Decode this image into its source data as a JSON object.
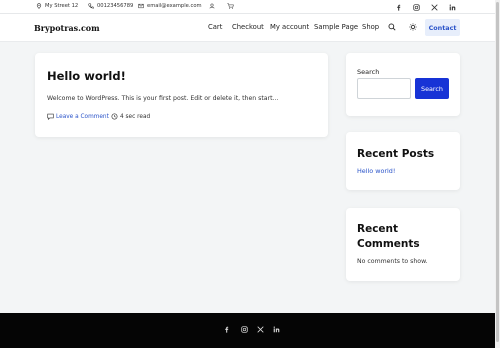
{
  "topbar": {
    "address": "My Street 12",
    "phone": "00123456789",
    "email": "email@example.com",
    "icons": [
      "map-pin-icon",
      "phone-icon",
      "mail-icon",
      "user-icon",
      "cart-icon"
    ],
    "social": [
      "facebook-icon",
      "instagram-icon",
      "x-icon",
      "linkedin-icon"
    ]
  },
  "header": {
    "logo": "Brypotras.com",
    "nav": [
      "Cart",
      "Checkout",
      "My account",
      "Sample Page",
      "Shop"
    ],
    "contact_label": "Contact"
  },
  "post": {
    "title": "Hello world!",
    "excerpt": "Welcome to WordPress. This is your first post. Edit or delete it, then start...",
    "comment_link": "Leave a Comment",
    "read_time": "4 sec read"
  },
  "sidebar": {
    "search": {
      "label": "Search",
      "placeholder": "",
      "button": "Search"
    },
    "recent_posts": {
      "title": "Recent Posts",
      "items": [
        "Hello world!"
      ]
    },
    "recent_comments": {
      "title_line1": "Recent",
      "title_line2": "Comments",
      "empty": "No comments to show."
    }
  },
  "footer": {
    "social": [
      "facebook-icon",
      "instagram-icon",
      "x-icon",
      "linkedin-icon"
    ]
  },
  "colors": {
    "accent": "#1733d6",
    "link": "#2a53c9",
    "footer_bg": "#050505",
    "page_bg": "#f3f5f6"
  }
}
